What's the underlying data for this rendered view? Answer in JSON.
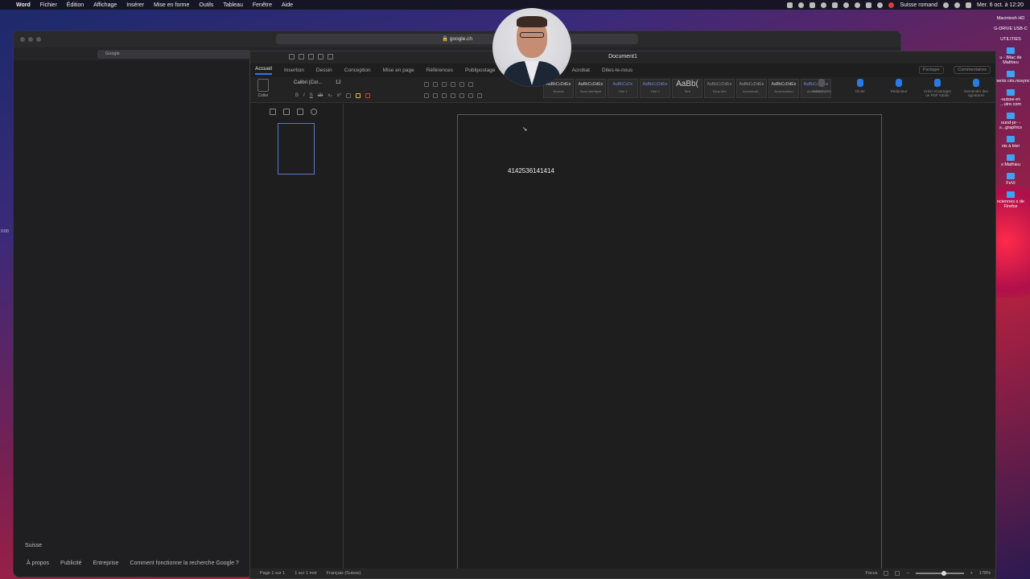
{
  "menubar": {
    "app": "Word",
    "items": [
      "Fichier",
      "Édition",
      "Affichage",
      "Insérer",
      "Mise en forme",
      "Outils",
      "Tableau",
      "Fenêtre",
      "Aide"
    ],
    "keyboard": "Suisse romand",
    "datetime": "Mer. 6 oct. à 12:20"
  },
  "desktop_icons": [
    {
      "label": "Macintosh HD"
    },
    {
      "label": "G-DRIVE USB-C"
    },
    {
      "label": "UTILITIES"
    },
    {
      "label": "u - iMac de Mathieu"
    },
    {
      "label": "éments cés.nosync"
    },
    {
      "label": "-suisse-et- ...utre.com"
    },
    {
      "label": "ound-pr- -s...graphics"
    },
    {
      "label": "nis à trier"
    },
    {
      "label": "s Mathieu"
    },
    {
      "label": "FeVi"
    },
    {
      "label": "nciennes s de Firefox"
    }
  ],
  "browser": {
    "url": "google.ch",
    "tab_title": "Google",
    "footer_country": "Suisse",
    "footer_links": [
      "À propos",
      "Publicité",
      "Entreprise",
      "Comment fonctionne la recherche Google ?"
    ],
    "left_time": "0:00"
  },
  "word": {
    "title": "Document1",
    "tabs": [
      "Accueil",
      "Insertion",
      "Dessin",
      "Conception",
      "Mise en page",
      "Références",
      "Publipostage"
    ],
    "tabs_right": [
      "Acrobat"
    ],
    "tell_me": "Dites-le-nous",
    "share": "Partager",
    "comments": "Commentaires",
    "paste_label": "Coller",
    "font_name": "Calibri (Cor...",
    "font_size": "12",
    "styles": [
      {
        "preview": "AaBbCcDdEe",
        "name": "Normal"
      },
      {
        "preview": "AaBbCcDdEe",
        "name": "Sans interligne"
      },
      {
        "preview": "AaBbCcDc",
        "name": "Titre 1"
      },
      {
        "preview": "AaBbCcDdEe",
        "name": "Titre 2"
      },
      {
        "preview": "AaBb(",
        "name": "Titre"
      },
      {
        "preview": "AaBbCcDdEe",
        "name": "Sous-titre"
      },
      {
        "preview": "AaBbCcDdEe",
        "name": "Accentuati..."
      },
      {
        "preview": "AaBbCcDdEe",
        "name": "Accentuation"
      },
      {
        "preview": "AaBbCcDdEe",
        "name": "Accentuati..."
      }
    ],
    "ribbon_right": [
      {
        "label": "Volet Styles"
      },
      {
        "label": "Dicter"
      },
      {
        "label": "Rédacteur"
      },
      {
        "label": "Créer et partager un PDF Adobe"
      },
      {
        "label": "Demander des signatures"
      }
    ],
    "document_text": "4142536141414",
    "status": {
      "page": "Page 1 sur 1",
      "words": "1 sur 1 mot",
      "language": "Français (Suisse)",
      "focus": "Focus",
      "zoom": "178%"
    }
  }
}
